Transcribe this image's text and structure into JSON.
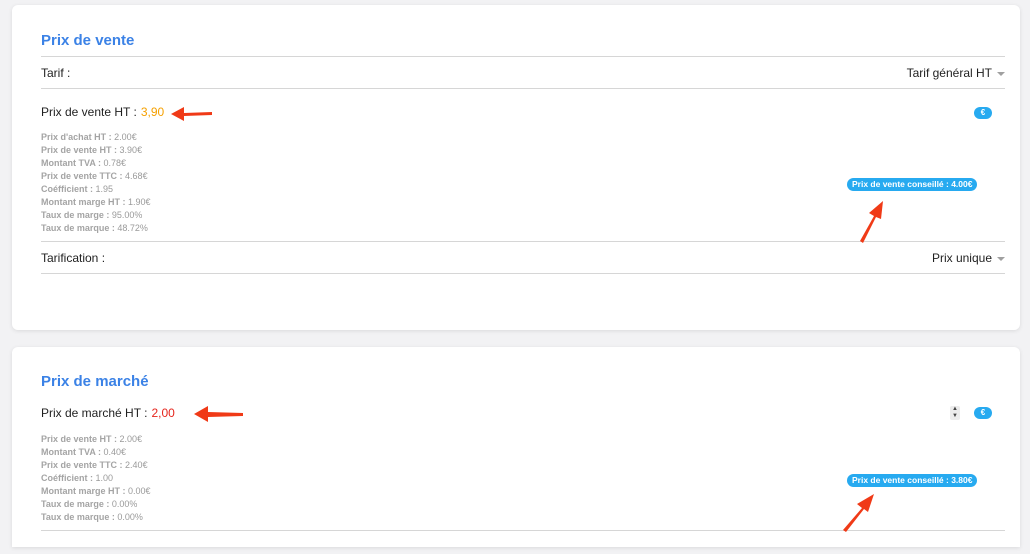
{
  "sale_card": {
    "title": "Prix de vente",
    "tarif_label": "Tarif :",
    "tarif_value": "Tarif général HT",
    "price_label": "Prix de vente HT :",
    "price_value": "3,90",
    "euro_symbol": "€",
    "details": [
      {
        "label": "Prix d'achat HT :",
        "value": "2.00€"
      },
      {
        "label": "Prix de vente HT :",
        "value": "3.90€"
      },
      {
        "label": "Montant TVA :",
        "value": "0.78€"
      },
      {
        "label": "Prix de vente TTC :",
        "value": "4.68€"
      },
      {
        "label": "Coéfficient :",
        "value": "1.95"
      },
      {
        "label": "Montant marge HT :",
        "value": "1.90€"
      },
      {
        "label": "Taux de marge :",
        "value": "95.00%"
      },
      {
        "label": "Taux de marque :",
        "value": "48.72%"
      }
    ],
    "suggested_badge": "Prix de vente conseillé : 4.00€",
    "tarification_label": "Tarification :",
    "tarification_value": "Prix unique"
  },
  "market_card": {
    "title": "Prix de marché",
    "price_label": "Prix de marché HT :",
    "price_value": "2,00",
    "euro_symbol": "€",
    "stepper_up": "▲",
    "stepper_down": "▼",
    "details": [
      {
        "label": "Prix de vente HT :",
        "value": "2.00€"
      },
      {
        "label": "Montant TVA :",
        "value": "0.40€"
      },
      {
        "label": "Prix de vente TTC :",
        "value": "2.40€"
      },
      {
        "label": "Coéfficient :",
        "value": "1.00"
      },
      {
        "label": "Montant marge HT :",
        "value": "0.00€"
      },
      {
        "label": "Taux de marge :",
        "value": "0.00%"
      },
      {
        "label": "Taux de marque :",
        "value": "0.00%"
      }
    ],
    "suggested_badge": "Prix de vente conseillé : 3.80€"
  },
  "colors": {
    "accent": "#3b82e6",
    "badge": "#27aaf0",
    "sale_price": "#f5a000",
    "market_price": "#e5251c",
    "annotation_arrow": "#f03a17"
  },
  "icons": [
    "dropdown-caret-icon",
    "euro-icon",
    "stepper-icon",
    "annotation-arrow-icon"
  ]
}
